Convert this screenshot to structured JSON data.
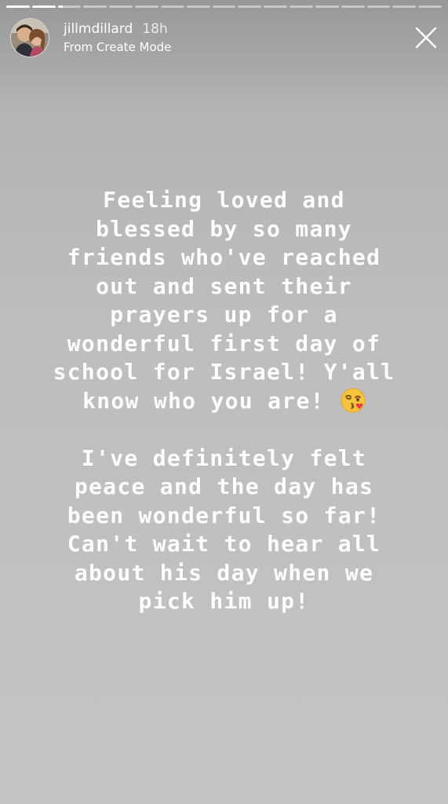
{
  "story": {
    "progress": {
      "segments": 17,
      "completed": 2,
      "current_fraction": 0.2
    },
    "username": "jillmdillard",
    "time": "18h",
    "subtitle": "From Create Mode",
    "paragraph_1": "Feeling loved and\nblessed by so many\nfriends who've reached\nout and sent their\nprayers up for a\nwonderful first day of\nschool for Israel! Y'all\nknow who you are! ",
    "emoji": "face-blowing-a-kiss",
    "paragraph_2": "I've definitely felt\npeace and the day has\nbeen wonderful so far!\nCan't wait to hear all\nabout his day when we\npick him up!"
  },
  "colors": {
    "background": "#bdbdbd",
    "text": "#ffffff"
  }
}
